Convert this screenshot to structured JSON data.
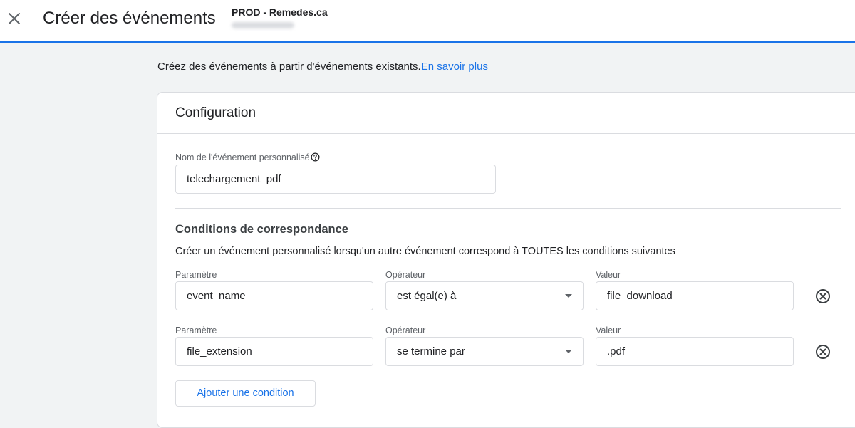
{
  "header": {
    "title": "Créer des événements",
    "property_name": "PROD - Remedes.ca"
  },
  "intro": {
    "text": "Créez des événements à partir d'événements existants.",
    "link": "En savoir plus"
  },
  "configuration": {
    "title": "Configuration",
    "event_name_label": "Nom de l'événement personnalisé",
    "event_name_value": "telechargement_pdf"
  },
  "conditions": {
    "title": "Conditions de correspondance",
    "description": "Créer un événement personnalisé lorsqu'un autre événement correspond à TOUTES les conditions suivantes",
    "rows": [
      {
        "param_label": "Paramètre",
        "param_value": "event_name",
        "op_label": "Opérateur",
        "op_value": "est égal(e) à",
        "value_label": "Valeur",
        "value_value": "file_download"
      },
      {
        "param_label": "Paramètre",
        "param_value": "file_extension",
        "op_label": "Opérateur",
        "op_value": "se termine par",
        "value_label": "Valeur",
        "value_value": ".pdf"
      }
    ],
    "add_button": "Ajouter une condition"
  },
  "icons": {
    "close": "close-icon",
    "help": "help-circle-icon",
    "dropdown": "chevron-down-icon",
    "remove": "remove-circle-icon"
  },
  "colors": {
    "accent": "#1a73e8",
    "background": "#f1f3f4",
    "border": "#dadce0"
  }
}
